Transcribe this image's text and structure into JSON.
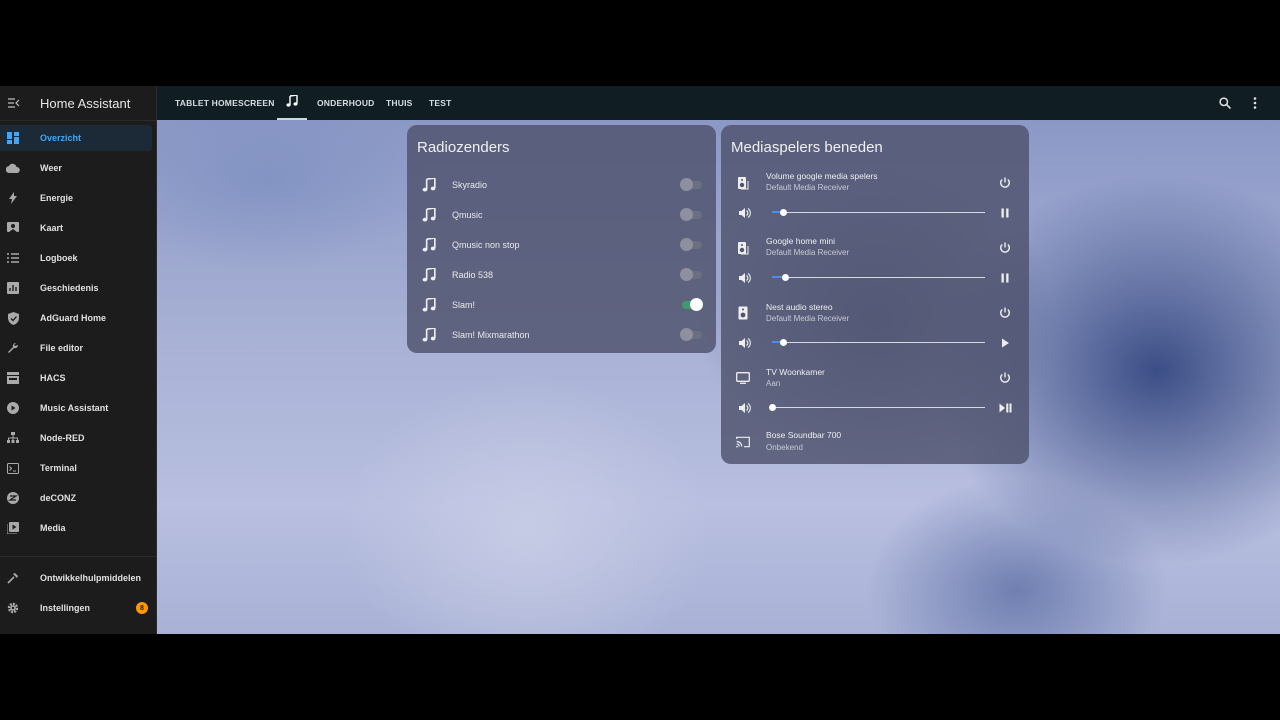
{
  "sidebar": {
    "title": "Home Assistant",
    "items": [
      {
        "label": "Overzicht",
        "icon": "dashboard-icon"
      },
      {
        "label": "Weer",
        "icon": "cloud-icon"
      },
      {
        "label": "Energie",
        "icon": "lightning-icon"
      },
      {
        "label": "Kaart",
        "icon": "map-icon"
      },
      {
        "label": "Logboek",
        "icon": "list-icon"
      },
      {
        "label": "Geschiedenis",
        "icon": "chart-icon"
      },
      {
        "label": "AdGuard Home",
        "icon": "shield-icon"
      },
      {
        "label": "File editor",
        "icon": "wrench-icon"
      },
      {
        "label": "HACS",
        "icon": "hacs-icon"
      },
      {
        "label": "Music Assistant",
        "icon": "play-circle-icon"
      },
      {
        "label": "Node-RED",
        "icon": "sitemap-icon"
      },
      {
        "label": "Terminal",
        "icon": "console-icon"
      },
      {
        "label": "deCONZ",
        "icon": "zigbee-icon"
      },
      {
        "label": "Media",
        "icon": "media-icon"
      }
    ],
    "bottom": [
      {
        "label": "Ontwikkelhulpmiddelen",
        "icon": "hammer-icon"
      },
      {
        "label": "Instellingen",
        "icon": "gear-icon",
        "badge": "8"
      }
    ]
  },
  "topbar": {
    "tabs": [
      "TABLET HOMESCREEN",
      "ONDERHOUD",
      "THUIS",
      "TEST"
    ],
    "active_tab_icon": "music-note-icon"
  },
  "radio_card": {
    "title": "Radiozenders",
    "stations": [
      {
        "label": "Skyradio",
        "on": false
      },
      {
        "label": "Qmusic",
        "on": false
      },
      {
        "label": "Qmusic non stop",
        "on": false
      },
      {
        "label": "Radio 538",
        "on": false
      },
      {
        "label": "Slam!",
        "on": true
      },
      {
        "label": "Slam! Mixmarathon",
        "on": false
      }
    ]
  },
  "media_card": {
    "title": "Mediaspelers beneden",
    "players": [
      {
        "name": "Volume google media spelers",
        "status": "Default Media Receiver",
        "icon": "speaker-group-icon",
        "volume": 0.05,
        "control": "pause-icon"
      },
      {
        "name": "Google home mini",
        "status": "Default Media Receiver",
        "icon": "speaker-group-icon",
        "volume": 0.06,
        "control": "pause-icon"
      },
      {
        "name": "Nest audio stereo",
        "status": "Default Media Receiver",
        "icon": "speaker-icon",
        "volume": 0.05,
        "control": "play-icon"
      },
      {
        "name": "TV Woonkamer",
        "status": "Aan",
        "icon": "tv-icon",
        "volume": 0.0,
        "control": "play-pause-icon"
      },
      {
        "name": "Bose Soundbar 700",
        "status": "Onbekend",
        "icon": "cast-icon"
      }
    ]
  },
  "colors": {
    "accent": "#42a5f5",
    "toggle_on": "#3f9b6b",
    "badge": "#ff9800",
    "topbar": "#101e24",
    "sidebar": "#1c1c1c"
  }
}
